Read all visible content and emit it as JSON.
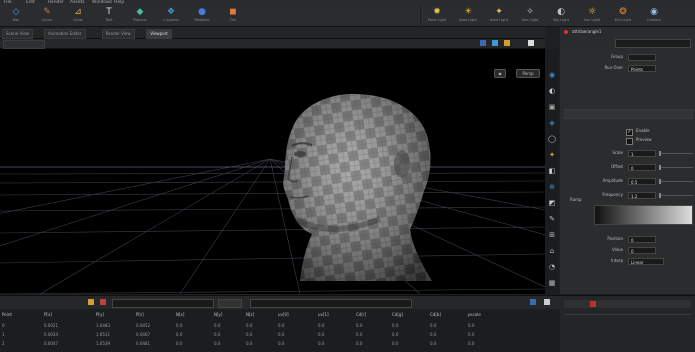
{
  "menu": [
    "File",
    "Edit",
    "Render",
    "Assets",
    "Windows",
    "Help"
  ],
  "shelf_left": [
    {
      "icon": "◇",
      "color": "#5aa0e0",
      "label": "Box"
    },
    {
      "icon": "✎",
      "color": "#c87a3a",
      "label": "Curve"
    },
    {
      "icon": "⊿",
      "color": "#e0b040",
      "label": "Draw"
    },
    {
      "icon": "T",
      "color": "#ddd",
      "label": "Text"
    },
    {
      "icon": "◆",
      "color": "#4ac0a0",
      "label": "Platonic"
    },
    {
      "icon": "❖",
      "color": "#3a9ae0",
      "label": "L-System"
    },
    {
      "icon": "●",
      "color": "#4a7ae0",
      "label": "Metaball"
    },
    {
      "icon": "◼",
      "color": "#e07a3a",
      "label": "File"
    }
  ],
  "shelf_right": [
    {
      "icon": "✹",
      "color": "#e0c040",
      "label": "Point Light"
    },
    {
      "icon": "☀",
      "color": "#e0b030",
      "label": "Spot Light"
    },
    {
      "icon": "✦",
      "color": "#e0c060",
      "label": "Area Light"
    },
    {
      "icon": "✧",
      "color": "#d0d0d0",
      "label": "Geo Light"
    },
    {
      "icon": "◐",
      "color": "#c0c0c0",
      "label": "Sky Light"
    },
    {
      "icon": "☼",
      "color": "#f0d040",
      "label": "Sun Light"
    },
    {
      "icon": "❂",
      "color": "#e08030",
      "label": "Env Light"
    },
    {
      "icon": "◉",
      "color": "#90c0e0",
      "label": "Camera"
    }
  ],
  "tabs": [
    "Scene View",
    "Animation Editor",
    "Render View",
    "Viewport"
  ],
  "active_tab_index": 3,
  "viewport": {
    "buttons": [
      "Persp",
      "No cam"
    ]
  },
  "right_panel": {
    "node_title": "attribwrangle1",
    "rows": [
      {
        "label": "Group",
        "value": ""
      },
      {
        "label": "Run Over",
        "value": "Points"
      },
      {
        "label": "Scale",
        "value": "1"
      },
      {
        "label": "Offset",
        "value": "0"
      },
      {
        "label": "Amplitude",
        "value": "0.5"
      },
      {
        "label": "Frequency",
        "value": "1.2"
      }
    ],
    "checks": [
      "Enable",
      "Preview"
    ],
    "ramp_label": "Ramp",
    "bottom_rows": [
      {
        "label": "Position",
        "value": "0"
      },
      {
        "label": "Value",
        "value": "0"
      },
      {
        "label": "Interp",
        "value": "Linear"
      }
    ]
  },
  "spreadsheet": {
    "headers": [
      "Point",
      "P[x]",
      "P[y]",
      "P[z]",
      "N[x]",
      "N[y]",
      "N[z]",
      "uv[0]",
      "uv[1]",
      "Cd[r]",
      "Cd[g]",
      "Cd[b]",
      "pscale"
    ],
    "rows": [
      [
        "0",
        "0.0021",
        "1.6483",
        "0.0452",
        "0.0",
        "0.0",
        "0.0",
        "0.0",
        "0.0",
        "0.0",
        "0.0",
        "0.0",
        "0.0"
      ],
      [
        "1",
        "0.0034",
        "1.6511",
        "0.0467",
        "0.0",
        "0.0",
        "0.0",
        "0.0",
        "0.0",
        "0.0",
        "0.0",
        "0.0",
        "0.0"
      ],
      [
        "2",
        "0.0047",
        "1.6539",
        "0.0481",
        "0.0",
        "0.0",
        "0.0",
        "0.0",
        "0.0",
        "0.0",
        "0.0",
        "0.0",
        "0.0"
      ]
    ]
  },
  "colors": {
    "accent": "#e0b030",
    "panel": "#2b2c2e",
    "viewport_bg": "#000000"
  }
}
